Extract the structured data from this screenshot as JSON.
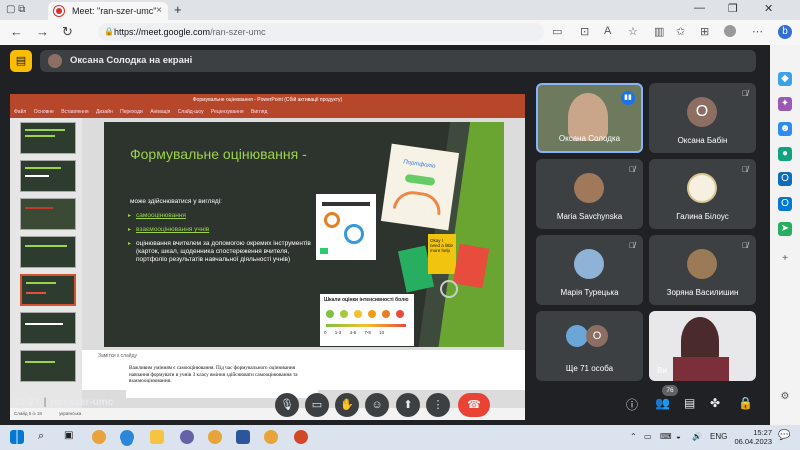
{
  "browser": {
    "tab_title": "Meet: \"ran-szer-umc\"",
    "tab_close": "×",
    "new_tab": "+",
    "url_host": "https://meet.google.com",
    "url_path": "/ran-szer-umc",
    "window_controls": [
      "—",
      "❐",
      "✕"
    ]
  },
  "meet": {
    "presenting_banner": "Оксана Солодка на екрані",
    "meeting_code": "ran-szer-umc",
    "time": "15:27",
    "participant_count": "76",
    "participants": [
      {
        "name": "Оксана Солодка",
        "type": "video",
        "speaking": true
      },
      {
        "name": "Оксана Бабін",
        "type": "avatar",
        "initial": "О",
        "color": "#8d6e63",
        "muted": true
      },
      {
        "name": "Maria Savchynska",
        "type": "photo",
        "muted": true
      },
      {
        "name": "Галина Білоус",
        "type": "photo",
        "muted": true
      },
      {
        "name": "Марія Турецька",
        "type": "photo",
        "muted": true
      },
      {
        "name": "Зоряна Василишин",
        "type": "photo",
        "muted": true
      },
      {
        "name": "Ще 71 особа",
        "type": "group",
        "initial": "О"
      },
      {
        "name": "Ви",
        "type": "video"
      }
    ]
  },
  "presentation": {
    "window_title": "Формувальне оцінювання - PowerPoint (Сбій активації продукту)",
    "ribbon_tabs": [
      "Файл",
      "Основне",
      "Вставлення",
      "Дизайн",
      "Переходи",
      "Анімація",
      "Слайд-шоу",
      "Рецензування",
      "Вигляд"
    ],
    "slide_title": "Формувальне оцінювання -",
    "slide_subtitle": "може здійснюватися у вигляді:",
    "bullets": [
      "самооцінювання",
      "взаємооцінювання учнів",
      "оцінювання вчителем за допомогою окремих інструментів (карток, шкал, щоденника спостереження вчителя, портфоліо результатів навчальної діяльності учнів)"
    ],
    "portfolio_label": "Портфоліо",
    "scale_title": "Шкали оцінки інтенсивності болю",
    "scale_numbers": [
      "0",
      "1-3",
      "4-6",
      "7-9",
      "10"
    ],
    "card_text": "Okay I need a little more help",
    "textbox_text": "Важливим умінням є самооцінювання. Під час формувального оцінювання навчання формувати в учнів 3 класу вміння здійснювати самооцінювання та взаємооцінювання.",
    "notes_placeholder": "Замітки к слайду",
    "status_left": "Слайд 5 із 18",
    "status_lang": "українська"
  },
  "taskbar": {
    "time": "15:27",
    "date": "06.04.2023",
    "lang": "ENG"
  }
}
